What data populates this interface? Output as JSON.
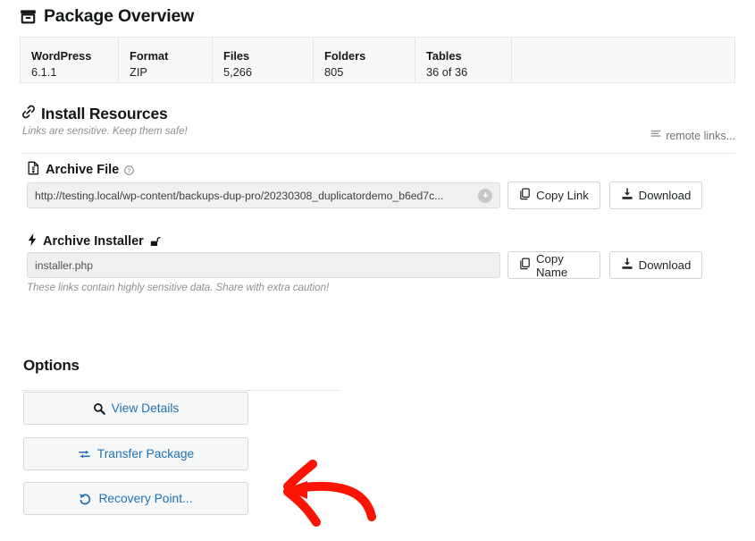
{
  "overview": {
    "title": "Package Overview",
    "title_icon": "archive-box-icon",
    "columns": [
      {
        "key": "WordPress",
        "value": "6.1.1"
      },
      {
        "key": "Format",
        "value": "ZIP"
      },
      {
        "key": "Files",
        "value": "5,266"
      },
      {
        "key": "Folders",
        "value": "805"
      },
      {
        "key": "Tables",
        "value": "36 of 36"
      }
    ]
  },
  "install_resources": {
    "title": "Install Resources",
    "title_icon": "link-chain-icon",
    "subtitle": "Links are sensitive. Keep them safe!",
    "remote_links_label": "remote links...",
    "remote_links_icon": "list-bars-icon",
    "archive_file": {
      "label": "Archive File",
      "label_icon": "file-archive-icon",
      "help_icon": "question-circle-icon",
      "value": "http://testing.local/wp-content/backups-dup-pro/20230308_duplicatordemo_b6ed7c...",
      "clear_icon": "circle-down-arrow-icon",
      "copy_button": "Copy Link",
      "copy_icon": "copy-icon",
      "download_button": "Download",
      "download_icon": "download-icon"
    },
    "archive_installer": {
      "label": "Archive Installer",
      "label_icon": "lightning-bolt-icon",
      "lock_icon": "unlock-icon",
      "value": "installer.php",
      "copy_button": "Copy Name",
      "copy_icon": "copy-icon",
      "download_button": "Download",
      "download_icon": "download-icon"
    },
    "caution": "These links contain highly sensitive data. Share with extra caution!"
  },
  "options": {
    "title": "Options",
    "buttons": [
      {
        "label": "View Details",
        "icon": "magnifier-icon"
      },
      {
        "label": "Transfer Package",
        "icon": "exchange-arrows-icon"
      },
      {
        "label": "Recovery Point...",
        "icon": "rotate-left-icon"
      }
    ]
  },
  "annotation": {
    "shape": "hand-drawn-arrow-left",
    "color": "#fb1403",
    "points_to": "Recovery Point..."
  },
  "colors": {
    "link_blue": "#2271b1",
    "annotation_red": "#fb1403",
    "text": "#1d2327",
    "muted": "#8b8f94",
    "border": "#dcdcde",
    "field_bg": "#f0f0f1",
    "table_bg": "#f8f8f9"
  }
}
